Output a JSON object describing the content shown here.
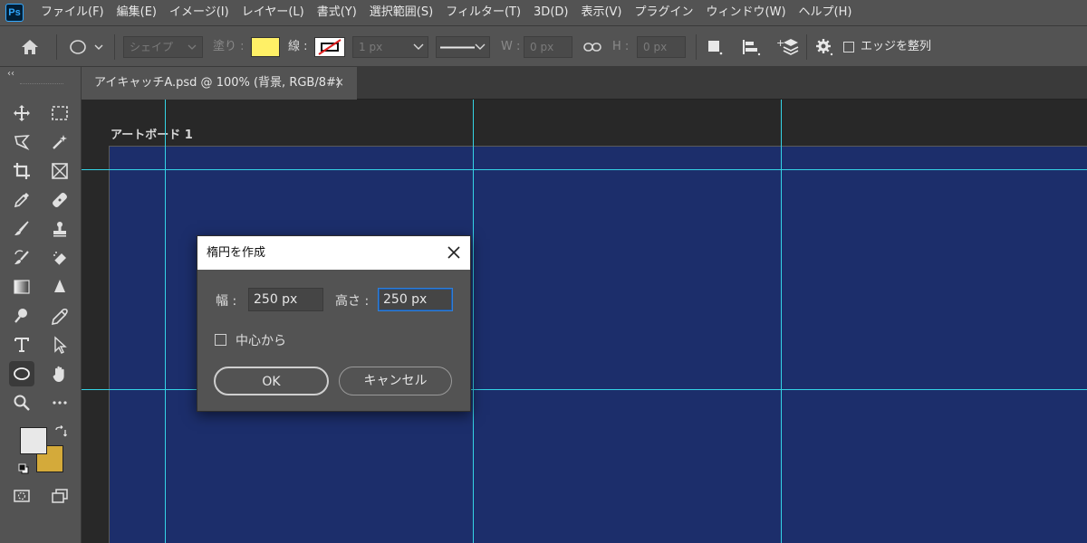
{
  "app": {
    "logo": "Ps"
  },
  "menubar": {
    "items": [
      "ファイル(F)",
      "編集(E)",
      "イメージ(I)",
      "レイヤー(L)",
      "書式(Y)",
      "選択範囲(S)",
      "フィルター(T)",
      "3D(D)",
      "表示(V)",
      "プラグイン",
      "ウィンドウ(W)",
      "ヘルプ(H)"
    ]
  },
  "options_bar": {
    "shape_mode": "シェイプ",
    "fill_label": "塗り :",
    "fill_color": "#fff066",
    "stroke_label": "線 :",
    "stroke_width": "1 px",
    "w_label": "W :",
    "w_value": "0 px",
    "h_label": "H :",
    "h_value": "0 px",
    "align_edges_label": "エッジを整列",
    "align_edges_checked": false
  },
  "document": {
    "tab_title": "アイキャッチA.psd @ 100% (背景, RGB/8#)",
    "tab_close": "×",
    "artboard_label": "アートボード 1",
    "artboard_color": "#1c2e6b",
    "guide_color": "#34d4e6"
  },
  "toolbar": {
    "collapse_glyph": "‹‹",
    "foreground_color": "#e8e8e8",
    "background_color": "#d4aa3a",
    "tools": [
      "move-icon",
      "marquee-icon",
      "lasso-icon",
      "magic-wand-icon",
      "crop-icon",
      "frame-icon",
      "eyedropper-icon",
      "healing-icon",
      "brush-icon",
      "stamp-icon",
      "history-brush-icon",
      "eraser-icon",
      "gradient-icon",
      "blur-icon",
      "dodge-icon",
      "pen-icon",
      "type-icon",
      "path-select-icon",
      "ellipse-icon",
      "hand-icon",
      "zoom-icon",
      "more-icon",
      "quickmask-icon",
      "screen-mode-icon"
    ],
    "active_tool": "ellipse-icon"
  },
  "dialog": {
    "title": "楕円を作成",
    "width_label": "幅 :",
    "width_value": "250 px",
    "height_label": "高さ :",
    "height_value": "250 px",
    "from_center_label": "中心から",
    "from_center_checked": false,
    "ok_label": "OK",
    "cancel_label": "キャンセル"
  }
}
